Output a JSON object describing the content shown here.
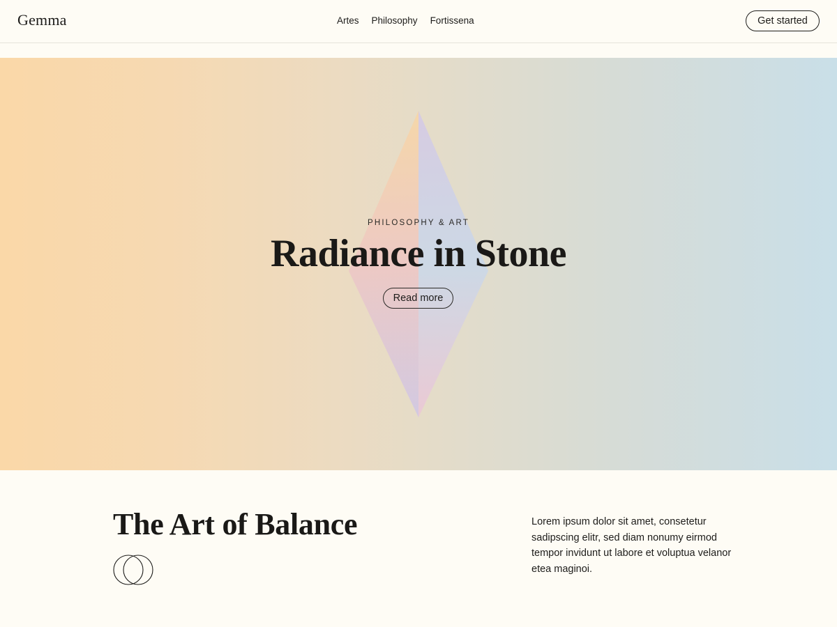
{
  "header": {
    "logo": "Gemma",
    "nav": [
      "Artes",
      "Philosophy",
      "Fortissena"
    ],
    "cta_label": "Get started"
  },
  "hero": {
    "eyebrow": "PHILOSOPHY & ART",
    "title": "Radiance in Stone",
    "button_label": "Read more",
    "gradient_colors": [
      "#fad8a8",
      "#e2dccb",
      "#c9dfe8"
    ],
    "gem_icon": "diamond-gem-icon"
  },
  "section": {
    "title": "The Art of Balance",
    "icon": "overlapping-rings-icon",
    "body": "Lorem ipsum dolor sit amet, consetetur sadipscing elitr, sed diam nonumy eirmod tempor invidunt ut labore et voluptua velanor etea maginoi."
  },
  "colors": {
    "background": "#fefcf5",
    "text": "#1d1c1a"
  }
}
